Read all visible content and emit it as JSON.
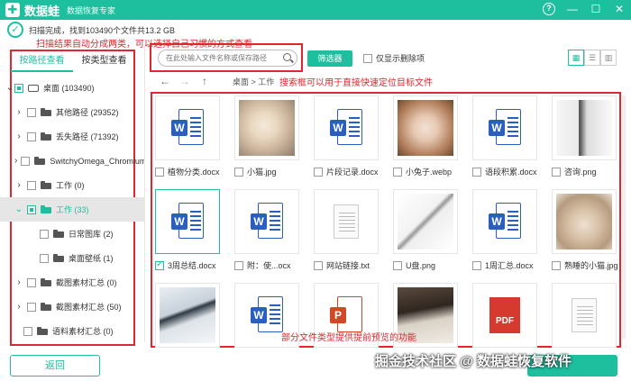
{
  "app": {
    "name": "数据蛙",
    "subtitle": "数据恢复专家",
    "logo_icon": "plus-logo-icon"
  },
  "window_controls": [
    "help-icon",
    "minimize-icon",
    "maximize-icon",
    "close-icon"
  ],
  "status": {
    "text": "扫描完成，找到103490个文件共13.2 GB"
  },
  "annotations": {
    "top": "扫描结果自动分成两类，可以选择自己习惯的方式查看",
    "search": "搜索框可以用于直接快速定位目标文件",
    "bottom": "部分文件类型提供提前预览的功能"
  },
  "sidebar": {
    "tabs": [
      "按路径查看",
      "按类型查看"
    ],
    "active_tab": 0,
    "items": [
      {
        "label": "桌面 (103490)"
      },
      {
        "label": "其他路径 (29352)"
      },
      {
        "label": "丢失路径 (71392)"
      },
      {
        "label": "SwitchyOmega_Chromium"
      },
      {
        "label": "工作 (0)"
      },
      {
        "label": "工作 (33)"
      },
      {
        "label": "日常图库 (2)"
      },
      {
        "label": "桌面壁纸 (1)"
      },
      {
        "label": "截图素材汇总 (0)"
      },
      {
        "label": "截图素材汇总 (50)"
      },
      {
        "label": "语料素材汇总 (0)"
      }
    ]
  },
  "toolbar": {
    "search_placeholder": "在此处输入文件名称或保存路径",
    "filter_label": "筛选器",
    "deleted_only_label": "仅显示删除项",
    "view_modes": [
      "grid-view-icon",
      "list-view-icon",
      "detail-view-icon"
    ]
  },
  "breadcrumb": {
    "path": "桌面 > 工作"
  },
  "files": [
    {
      "name": "植物分类.docx",
      "type": "word",
      "checked": false
    },
    {
      "name": "小猫.jpg",
      "type": "photo-cat",
      "checked": false
    },
    {
      "name": "片段记录.docx",
      "type": "word",
      "checked": false
    },
    {
      "name": "小兔子.webp",
      "type": "photo-rabbit",
      "checked": false
    },
    {
      "name": "语段积累.docx",
      "type": "word",
      "checked": false
    },
    {
      "name": "咨询.png",
      "type": "photo-office",
      "checked": false
    },
    {
      "name": "3周总结.docx",
      "type": "word",
      "checked": true
    },
    {
      "name": "附：使...ocx",
      "type": "word",
      "checked": false
    },
    {
      "name": "网站链接.txt",
      "type": "text",
      "checked": false
    },
    {
      "name": "U盘.png",
      "type": "photo-usb",
      "checked": false
    },
    {
      "name": "1周汇总.docx",
      "type": "word",
      "checked": false
    },
    {
      "name": "熟睡的小猫.jpg",
      "type": "photo-sleepcat",
      "checked": false
    },
    {
      "name": "",
      "type": "photo-laptop",
      "checked": false
    },
    {
      "name": "",
      "type": "word",
      "checked": false
    },
    {
      "name": "",
      "type": "ppt",
      "checked": false
    },
    {
      "name": "",
      "type": "photo-desk",
      "checked": false
    },
    {
      "name": "",
      "type": "pdf",
      "checked": false
    },
    {
      "name": "",
      "type": "text",
      "checked": false
    }
  ],
  "buttons": {
    "back": "返回"
  },
  "watermark": "掘金技术社区 @ 数据蛙恢复软件",
  "colors": {
    "accent": "#1dbf9f",
    "annotation": "#e0262f",
    "word": "#2b5fbd"
  }
}
